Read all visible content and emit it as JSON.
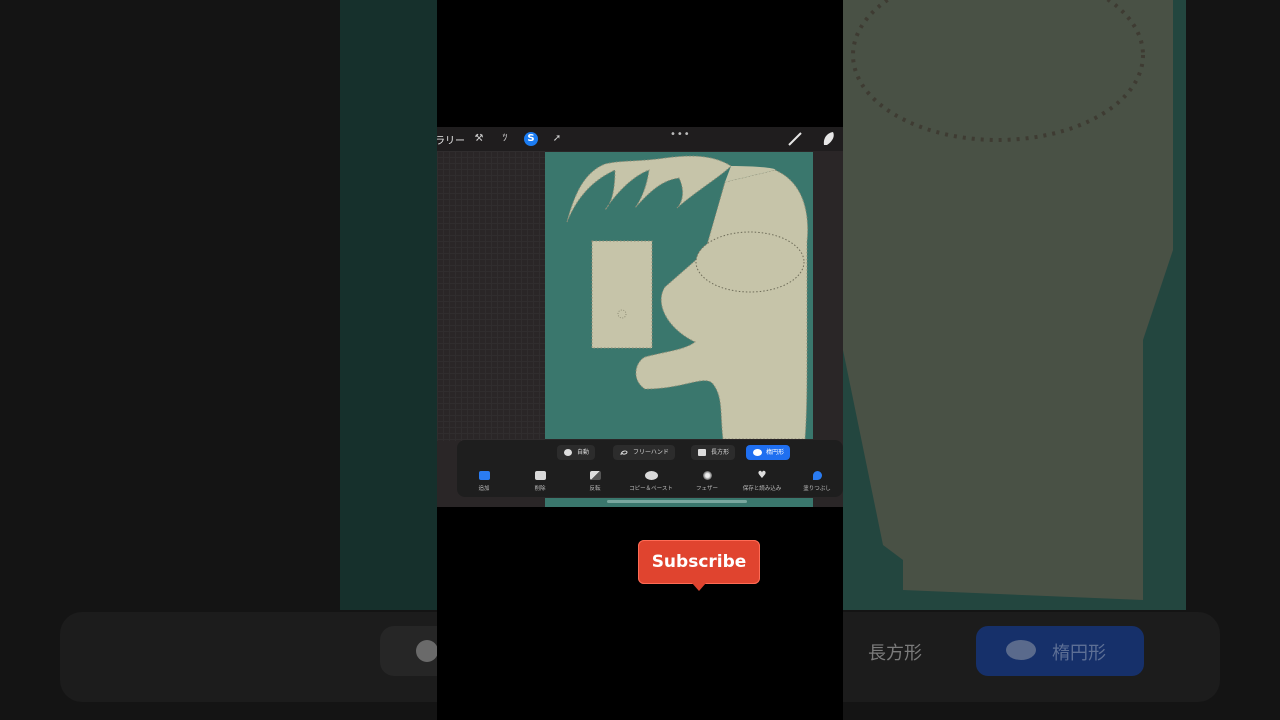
{
  "toolbar": {
    "gallery_label": "ラリー",
    "icons": [
      "wrench-icon",
      "magic-wand-icon",
      "selection-icon",
      "transform-icon",
      "brush-icon",
      "smudge-icon"
    ],
    "more_icon": "•••"
  },
  "selection": {
    "modes": [
      {
        "label": "自動",
        "icon": "circle-icon"
      },
      {
        "label": "フリーハンド",
        "icon": "freehand-icon"
      },
      {
        "label": "長方形",
        "icon": "rectangle-icon"
      },
      {
        "label": "楕円形",
        "icon": "ellipse-icon",
        "active": true
      }
    ],
    "actions": [
      {
        "label": "追加",
        "icon": "add-icon"
      },
      {
        "label": "削除",
        "icon": "remove-icon"
      },
      {
        "label": "反転",
        "icon": "invert-icon"
      },
      {
        "label": "コピー＆ペースト",
        "icon": "copy-paste-icon"
      },
      {
        "label": "フェザー",
        "icon": "feather-icon"
      },
      {
        "label": "保存と読み込み",
        "icon": "heart-icon"
      },
      {
        "label": "塗りつぶし",
        "icon": "fill-icon"
      }
    ]
  },
  "background_blur": {
    "rect_label": "長方形",
    "ellipse_label": "楕円形"
  },
  "subscribe": {
    "label": "Subscribe"
  },
  "colors": {
    "canvas": "#3a776d",
    "shape": "#c6c4a9",
    "accent": "#1f6ff0",
    "subscribe": "#e0442f"
  }
}
